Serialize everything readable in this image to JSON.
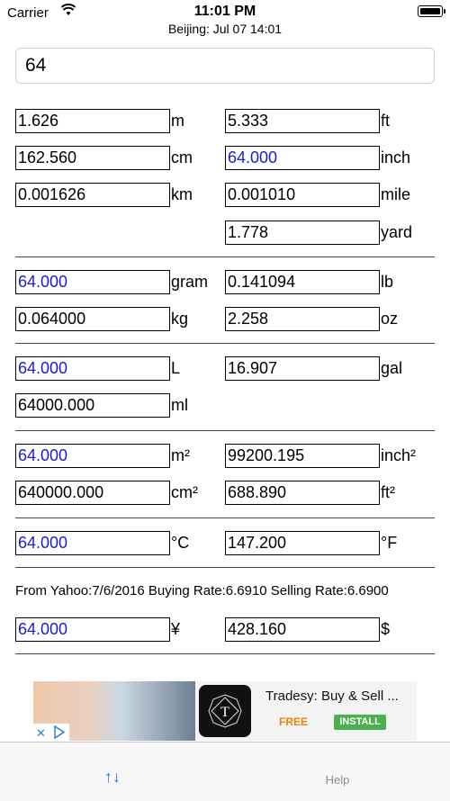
{
  "status": {
    "carrier": "Carrier",
    "time": "11:01 PM",
    "sub": "Beijing: Jul 07 14:01"
  },
  "input": {
    "value": "64"
  },
  "fields": {
    "m": "1.626",
    "ft": "5.333",
    "cm": "162.560",
    "inch": "64.000",
    "km": "0.001626",
    "mile": "0.001010",
    "yard": "1.778",
    "gram": "64.000",
    "lb": "0.141094",
    "kg": "0.064000",
    "oz": "2.258",
    "L": "64.000",
    "gal": "16.907",
    "ml": "64000.000",
    "m2": "64.000",
    "inch2": "99200.195",
    "cm2": "640000.000",
    "ft2": "688.890",
    "c": "64.000",
    "f": "147.200",
    "yuan": "64.000",
    "usd": "428.160"
  },
  "units": {
    "m": "m",
    "ft": "ft",
    "cm": "cm",
    "inch": "inch",
    "km": "km",
    "mile": "mile",
    "yard": "yard",
    "gram": "gram",
    "lb": "lb",
    "kg": "kg",
    "oz": "oz",
    "L": "L",
    "gal": "gal",
    "ml": "ml",
    "m2": "m²",
    "inch2": "inch²",
    "cm2": "cm²",
    "ft2": "ft²",
    "c": "°C",
    "f": "°F",
    "yuan": "¥",
    "usd": "$"
  },
  "rate_text": "From Yahoo:7/6/2016 Buying Rate:6.6910 Selling Rate:6.6900",
  "ad": {
    "title": "Tradesy: Buy & Sell ...",
    "free": "FREE",
    "install": "INSTALL",
    "logo_letter": "T"
  },
  "tabs": {
    "swap": "↑↓",
    "help": "Help"
  },
  "colors": {
    "blue_value": "#1a1ad6",
    "tab_active": "#1f6fe0"
  }
}
